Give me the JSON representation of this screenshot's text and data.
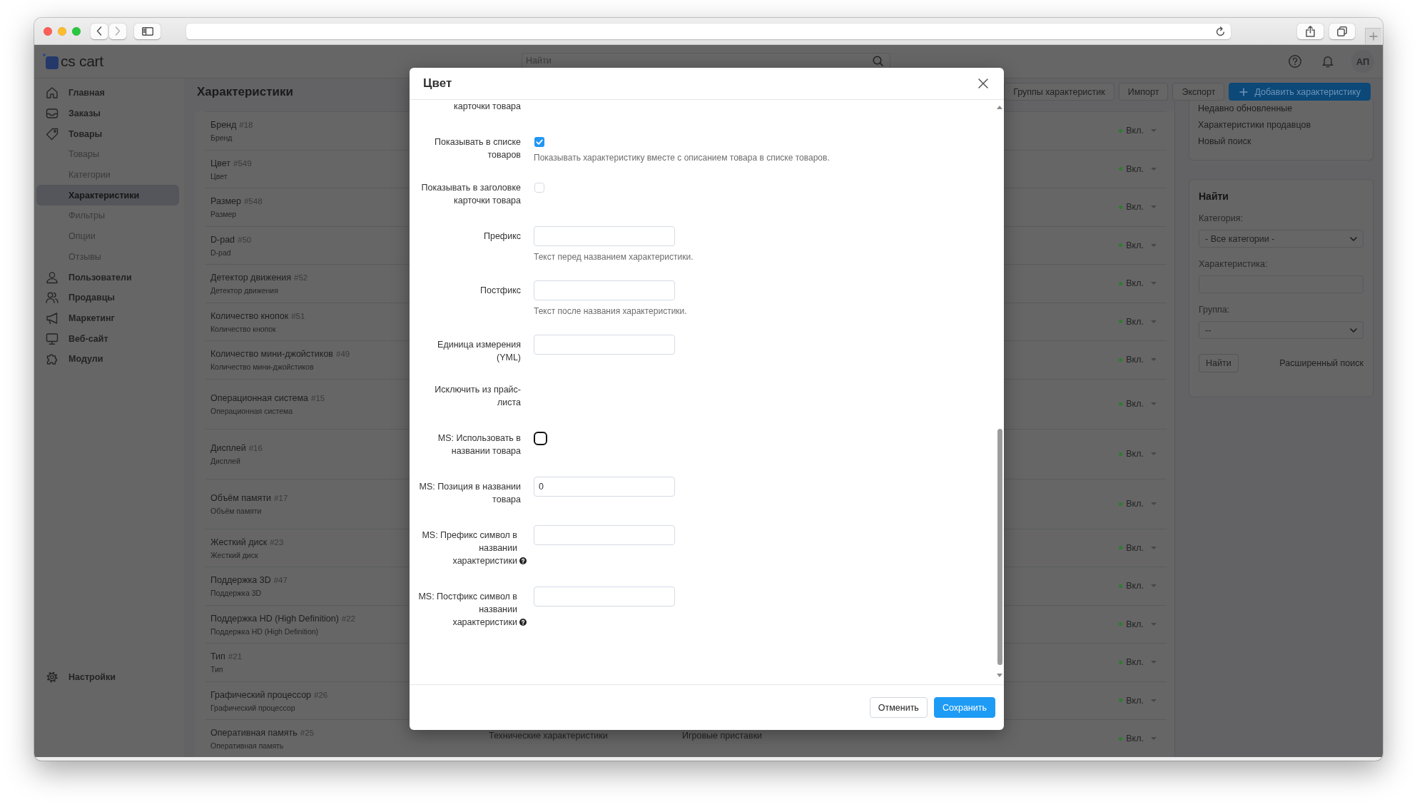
{
  "header": {
    "logo": "cs cart",
    "search": {
      "placeholder": "Найти"
    },
    "avatar": "АП"
  },
  "sidebar": {
    "items": [
      {
        "label": "Главная",
        "selected": false
      },
      {
        "label": "Заказы",
        "selected": false
      },
      {
        "label": "Товары",
        "selected": false,
        "children": [
          {
            "label": "Товары",
            "selected": false
          },
          {
            "label": "Категории",
            "selected": false
          },
          {
            "label": "Характеристики",
            "selected": true
          },
          {
            "label": "Фильтры",
            "selected": false
          },
          {
            "label": "Опции",
            "selected": false
          },
          {
            "label": "Отзывы",
            "selected": false
          }
        ]
      },
      {
        "label": "Пользователи",
        "selected": false
      },
      {
        "label": "Продавцы",
        "selected": false
      },
      {
        "label": "Маркетинг",
        "selected": false
      },
      {
        "label": "Веб-сайт",
        "selected": false
      },
      {
        "label": "Модули",
        "selected": false
      }
    ],
    "footer_item": {
      "label": "Настройки",
      "selected": false
    }
  },
  "page": {
    "title": "Характеристики",
    "buttons": [
      {
        "label": "Группы характеристик",
        "kind": "default"
      },
      {
        "label": "Импорт",
        "kind": "default"
      },
      {
        "label": "Экспорт",
        "kind": "default"
      },
      {
        "label": "Добавить характеристику",
        "kind": "primary"
      }
    ]
  },
  "features": {
    "rows": [
      {
        "name": "Бренд",
        "number": "#18",
        "subtitle": "Бренд",
        "status": "Вкл.",
        "enabled": true
      },
      {
        "name": "Цвет",
        "number": "#549",
        "subtitle": "Цвет",
        "status": "Вкл.",
        "enabled": true
      },
      {
        "name": "Размер",
        "number": "#548",
        "subtitle": "Размер",
        "status": "Вкл.",
        "enabled": true
      },
      {
        "name": "D-pad",
        "number": "#50",
        "subtitle": "D-pad",
        "status": "Вкл.",
        "enabled": true
      },
      {
        "name": "Детектор движения",
        "number": "#52",
        "subtitle": "Детектор движения",
        "status": "Вкл.",
        "enabled": true
      },
      {
        "name": "Количество кнопок",
        "number": "#51",
        "subtitle": "Количество кнопок",
        "status": "Вкл.",
        "enabled": true
      },
      {
        "name": "Количество мини-джойстиков",
        "number": "#49",
        "subtitle": "Количество мини-джойстиков",
        "status": "Вкл.",
        "enabled": true
      },
      {
        "name": "Операционная система",
        "number": "#15",
        "subtitle": "Операционная система",
        "status": "Вкл.",
        "enabled": true
      },
      {
        "name": "Дисплей",
        "number": "#16",
        "subtitle": "Дисплей",
        "status": "Вкл.",
        "enabled": true
      },
      {
        "name": "Объём памяти",
        "number": "#17",
        "subtitle": "Объём памяти",
        "status": "Вкл.",
        "enabled": true
      },
      {
        "name": "Жесткий диск",
        "number": "#23",
        "subtitle": "Жесткий диск",
        "status": "Вкл.",
        "enabled": true
      },
      {
        "name": "Поддержка 3D",
        "number": "#47",
        "subtitle": "Поддержка 3D",
        "status": "Вкл.",
        "enabled": true
      },
      {
        "name": "Поддержка HD (High Definition)",
        "number": "#22",
        "subtitle": "Поддержка HD (High Definition)",
        "status": "Вкл.",
        "enabled": true
      },
      {
        "name": "Тип",
        "number": "#21",
        "subtitle": "Тип",
        "status": "Вкл.",
        "enabled": true
      },
      {
        "name": "Графический процессор",
        "number": "#26",
        "subtitle": "Графический процессор",
        "status": "Вкл.",
        "enabled": true
      },
      {
        "name": "Оперативная память",
        "number": "#25",
        "subtitle": "Оперативная память",
        "column_2": "Технические характеристики",
        "column_3": "Игровые приставки",
        "status": "Вкл.",
        "enabled": true
      }
    ]
  },
  "right_panel": {
    "saved_searches": [
      "Недавно обновленные",
      "Характеристики продавцов",
      "Новый поиск"
    ],
    "search": {
      "title": "Найти",
      "fields": [
        {
          "label": "Категория:",
          "kind": "select",
          "value": "- Все категории -"
        },
        {
          "label": "Характеристика:",
          "kind": "text"
        },
        {
          "label": "Группа:",
          "kind": "select",
          "value": "--"
        }
      ],
      "submit": "Найти",
      "advanced_link": "Расширенный поиск"
    }
  },
  "modal": {
    "title": "Цвет",
    "fields": [
      {
        "label": "карточки товара",
        "kind": "label"
      },
      {
        "label": "Показывать в списке товаров",
        "kind": "checkbox",
        "checked": true,
        "hint": "Показывать характеристику вместе с описанием товара в списке товаров."
      },
      {
        "label": "Показывать в заголовке карточки товара",
        "kind": "checkbox",
        "checked": false
      },
      {
        "label": "Префикс",
        "kind": "input",
        "hint": "Текст перед названием характеристики."
      },
      {
        "label": "Постфикс",
        "kind": "input",
        "hint": "Текст после названия характеристики."
      },
      {
        "label": "Единица измерения (YML)",
        "kind": "input"
      },
      {
        "label": "Исключить из прайс-листа",
        "kind": "label"
      },
      {
        "label": "MS: Использовать в названии товара",
        "kind": "outlinecheck",
        "checked": false
      },
      {
        "label": "MS: Позиция в названии товара",
        "kind": "input",
        "value": "0"
      },
      {
        "label": "MS: Префикс символ в названии характеристики",
        "kind": "input",
        "help": true
      },
      {
        "label": "MS: Постфикс символ в названии характеристики",
        "kind": "input",
        "help": true
      }
    ],
    "buttons": [
      {
        "label": "Отменить",
        "kind": "default"
      },
      {
        "label": "Сохранить",
        "kind": "primary"
      }
    ]
  }
}
